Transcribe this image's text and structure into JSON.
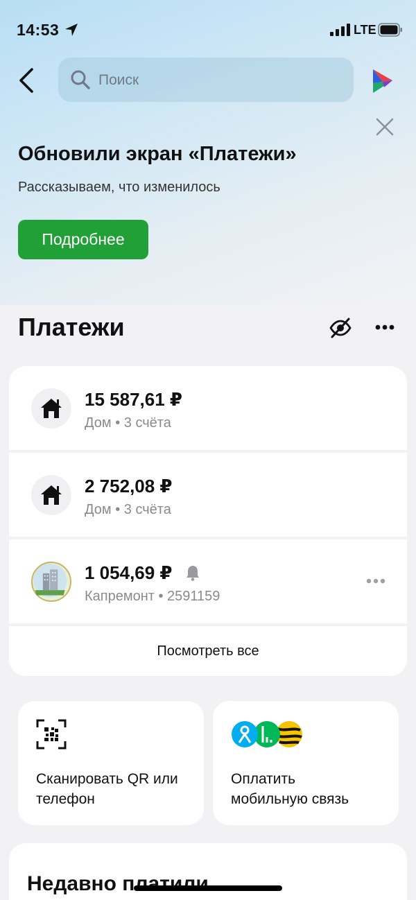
{
  "status_bar": {
    "time": "14:53",
    "network": "LTE"
  },
  "search": {
    "placeholder": "Поиск"
  },
  "banner": {
    "title": "Обновили экран «Платежи»",
    "subtitle": "Рассказываем, что изменилось",
    "button_label": "Подробнее"
  },
  "payments": {
    "title": "Платежи",
    "items": [
      {
        "amount": "15 587,61 ₽",
        "subtitle": "Дом • 3 счёта",
        "icon": "house-icon"
      },
      {
        "amount": "2 752,08 ₽",
        "subtitle": "Дом • 3 счёта",
        "icon": "house-icon"
      },
      {
        "amount": "1 054,69 ₽",
        "subtitle": "Капремонт • 2591159",
        "icon": "building-photo"
      }
    ],
    "see_all_label": "Посмотреть все"
  },
  "quick_actions": [
    {
      "label": "Сканировать QR или\nтелефон",
      "icon": "qr-scan-icon"
    },
    {
      "label": "Оплатить\nмобильную связь",
      "icon": "mobile-operators-logos"
    }
  ],
  "recent": {
    "title": "Недавно платили"
  },
  "colors": {
    "accent": "#21a038",
    "background": "#f2f2f4",
    "card": "#ffffff",
    "muted_text": "#8a8a8e"
  }
}
